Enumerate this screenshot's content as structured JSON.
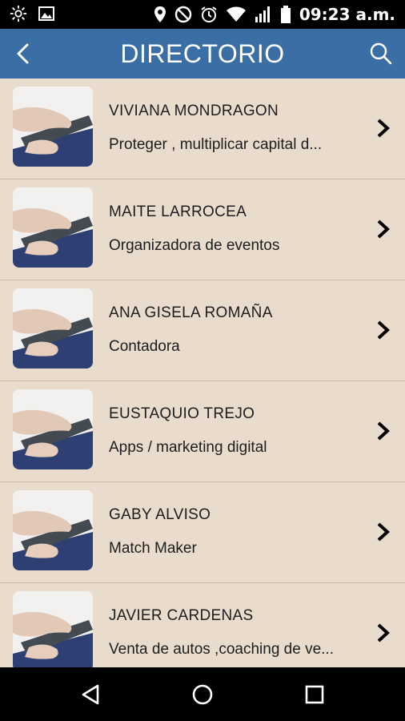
{
  "status_bar": {
    "time": "09:23 a.m.",
    "icons_left": [
      "brightness-icon",
      "image-icon"
    ],
    "icons_right": [
      "location-icon",
      "do-not-disturb-icon",
      "alarm-icon",
      "wifi-icon",
      "signal-icon",
      "battery-icon"
    ]
  },
  "header": {
    "title": "DIRECTORIO",
    "back_icon": "chevron-left-icon",
    "search_icon": "search-icon"
  },
  "colors": {
    "header_bg": "#3a6ea5",
    "list_bg": "#e9dccd",
    "text": "#1d1d1d"
  },
  "contacts": [
    {
      "name": "VIVIANA MONDRAGON",
      "description": "Proteger , multiplicar capital d..."
    },
    {
      "name": "MAITE LARROCEA",
      "description": "Organizadora de eventos"
    },
    {
      "name": "ANA GISELA ROMAÑA",
      "description": "Contadora"
    },
    {
      "name": "EUSTAQUIO TREJO",
      "description": "Apps / marketing digital"
    },
    {
      "name": "GABY ALVISO",
      "description": "Match Maker"
    },
    {
      "name": "JAVIER CARDENAS",
      "description": "Venta de autos ,coaching de ve..."
    }
  ],
  "nav_bar": {
    "icons": [
      "back-triangle-icon",
      "home-circle-icon",
      "recents-square-icon"
    ]
  }
}
